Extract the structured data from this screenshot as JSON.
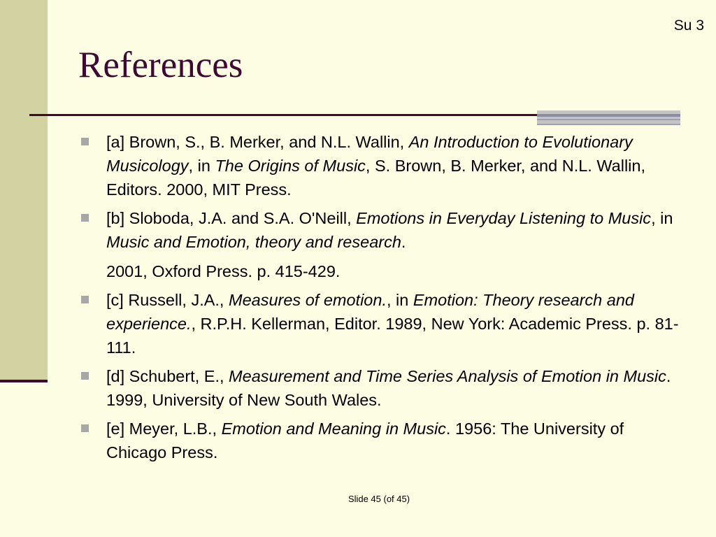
{
  "slide": {
    "corner_label": "Su 3",
    "title": "References",
    "footer": "Slide  45 (of  45)"
  },
  "refs": [
    {
      "p1": "[a] Brown, S., B. Merker, and N.L. Wallin, ",
      "i1": "An Introduction to Evolutionary Musicology",
      "p2": ", in ",
      "i2": "The Origins of Music",
      "p3": ", S. Brown, B. Merker, and N.L. Wallin, Editors. 2000, MIT Press."
    },
    {
      "p1": "[b] Sloboda, J.A. and S.A. O'Neill, ",
      "i1": "Emotions in Everyday Listening to Music",
      "p2": ", in ",
      "i2": "Music and Emotion, theory and research",
      "p3": ".",
      "p4": "2001, Oxford Press. p. 415-429."
    },
    {
      "p1": "[c] Russell, J.A., ",
      "i1": "Measures of emotion.",
      "p2": ", in ",
      "i2": "Emotion: Theory research and experience.",
      "p3": ", R.P.H. Kellerman, Editor. 1989, New York: Academic Press. p. 81-111."
    },
    {
      "p1": "[d] Schubert, E., ",
      "i1": "Measurement and Time Series Analysis of Emotion in Music",
      "p2": ". 1999, University of New South Wales."
    },
    {
      "p1": "[e] Meyer, L.B., ",
      "i1": "Emotion and Meaning in Music",
      "p2": ". 1956: The University of Chicago Press."
    }
  ]
}
